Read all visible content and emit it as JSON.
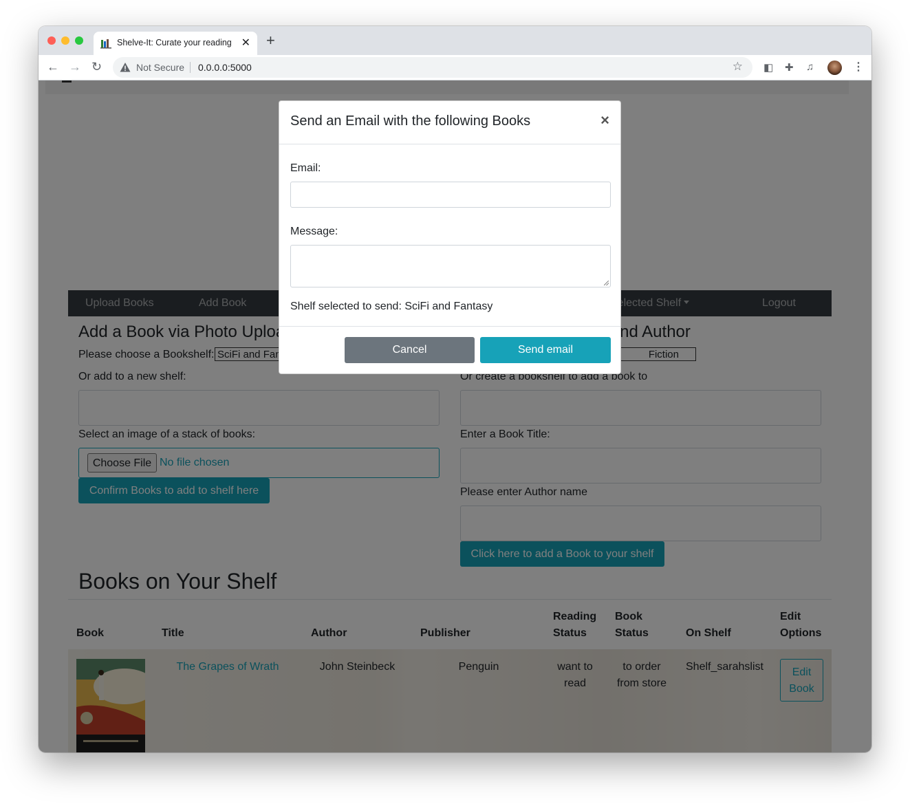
{
  "browser": {
    "tab_title": "Shelve-It: Curate your reading",
    "new_tab": "+",
    "security_label": "Not Secure",
    "url": "0.0.0.0:5000"
  },
  "nav": {
    "upload_books": "Upload Books",
    "add_book": "Add Book",
    "selected_shelf": "Selected Shelf",
    "logout": "Logout"
  },
  "upload_section": {
    "heading": "Add a Book via Photo Upload",
    "choose_label": "Please choose a Bookshelf:",
    "shelf_selected": "SciFi and Fantasy",
    "new_shelf_label": "Or add to a new shelf:",
    "image_label": "Select an image of a stack of books:",
    "choose_file": "Choose File",
    "no_file": "No file chosen",
    "confirm_button": "Confirm Books to add to shelf here"
  },
  "title_section": {
    "heading": "Add a Book via Title and Author",
    "shelf_selected": "Fiction",
    "create_shelf_label": "Or create a bookshelf to add a book to",
    "title_label": "Enter a Book Title:",
    "author_label": "Please enter Author name",
    "add_button": "Click here to add a Book to your shelf"
  },
  "shelf": {
    "heading": "Books on Your Shelf",
    "headers": {
      "book": "Book",
      "title": "Title",
      "author": "Author",
      "publisher": "Publisher",
      "reading_status_1": "Reading",
      "reading_status_2": "Status",
      "book_status_1": "Book",
      "book_status_2": "Status",
      "on_shelf": "On Shelf",
      "edit_1": "Edit",
      "edit_2": "Options"
    },
    "rows": [
      {
        "title": "The Grapes of Wrath",
        "author": "John Steinbeck",
        "publisher": "Penguin",
        "reading_status_1": "want to",
        "reading_status_2": "read",
        "book_status_1": "to order",
        "book_status_2": "from store",
        "on_shelf": "Shelf_sarahslist",
        "edit_1": "Edit",
        "edit_2": "Book"
      }
    ]
  },
  "modal": {
    "title": "Send an Email with the following Books",
    "close": "×",
    "email_label": "Email:",
    "message_label": "Message:",
    "shelf_info": "Shelf selected to send: SciFi and Fantasy",
    "cancel": "Cancel",
    "send": "Send email"
  },
  "colors": {
    "info": "#17a2b8",
    "secondary": "#6c757d",
    "navbar": "#343a40"
  }
}
